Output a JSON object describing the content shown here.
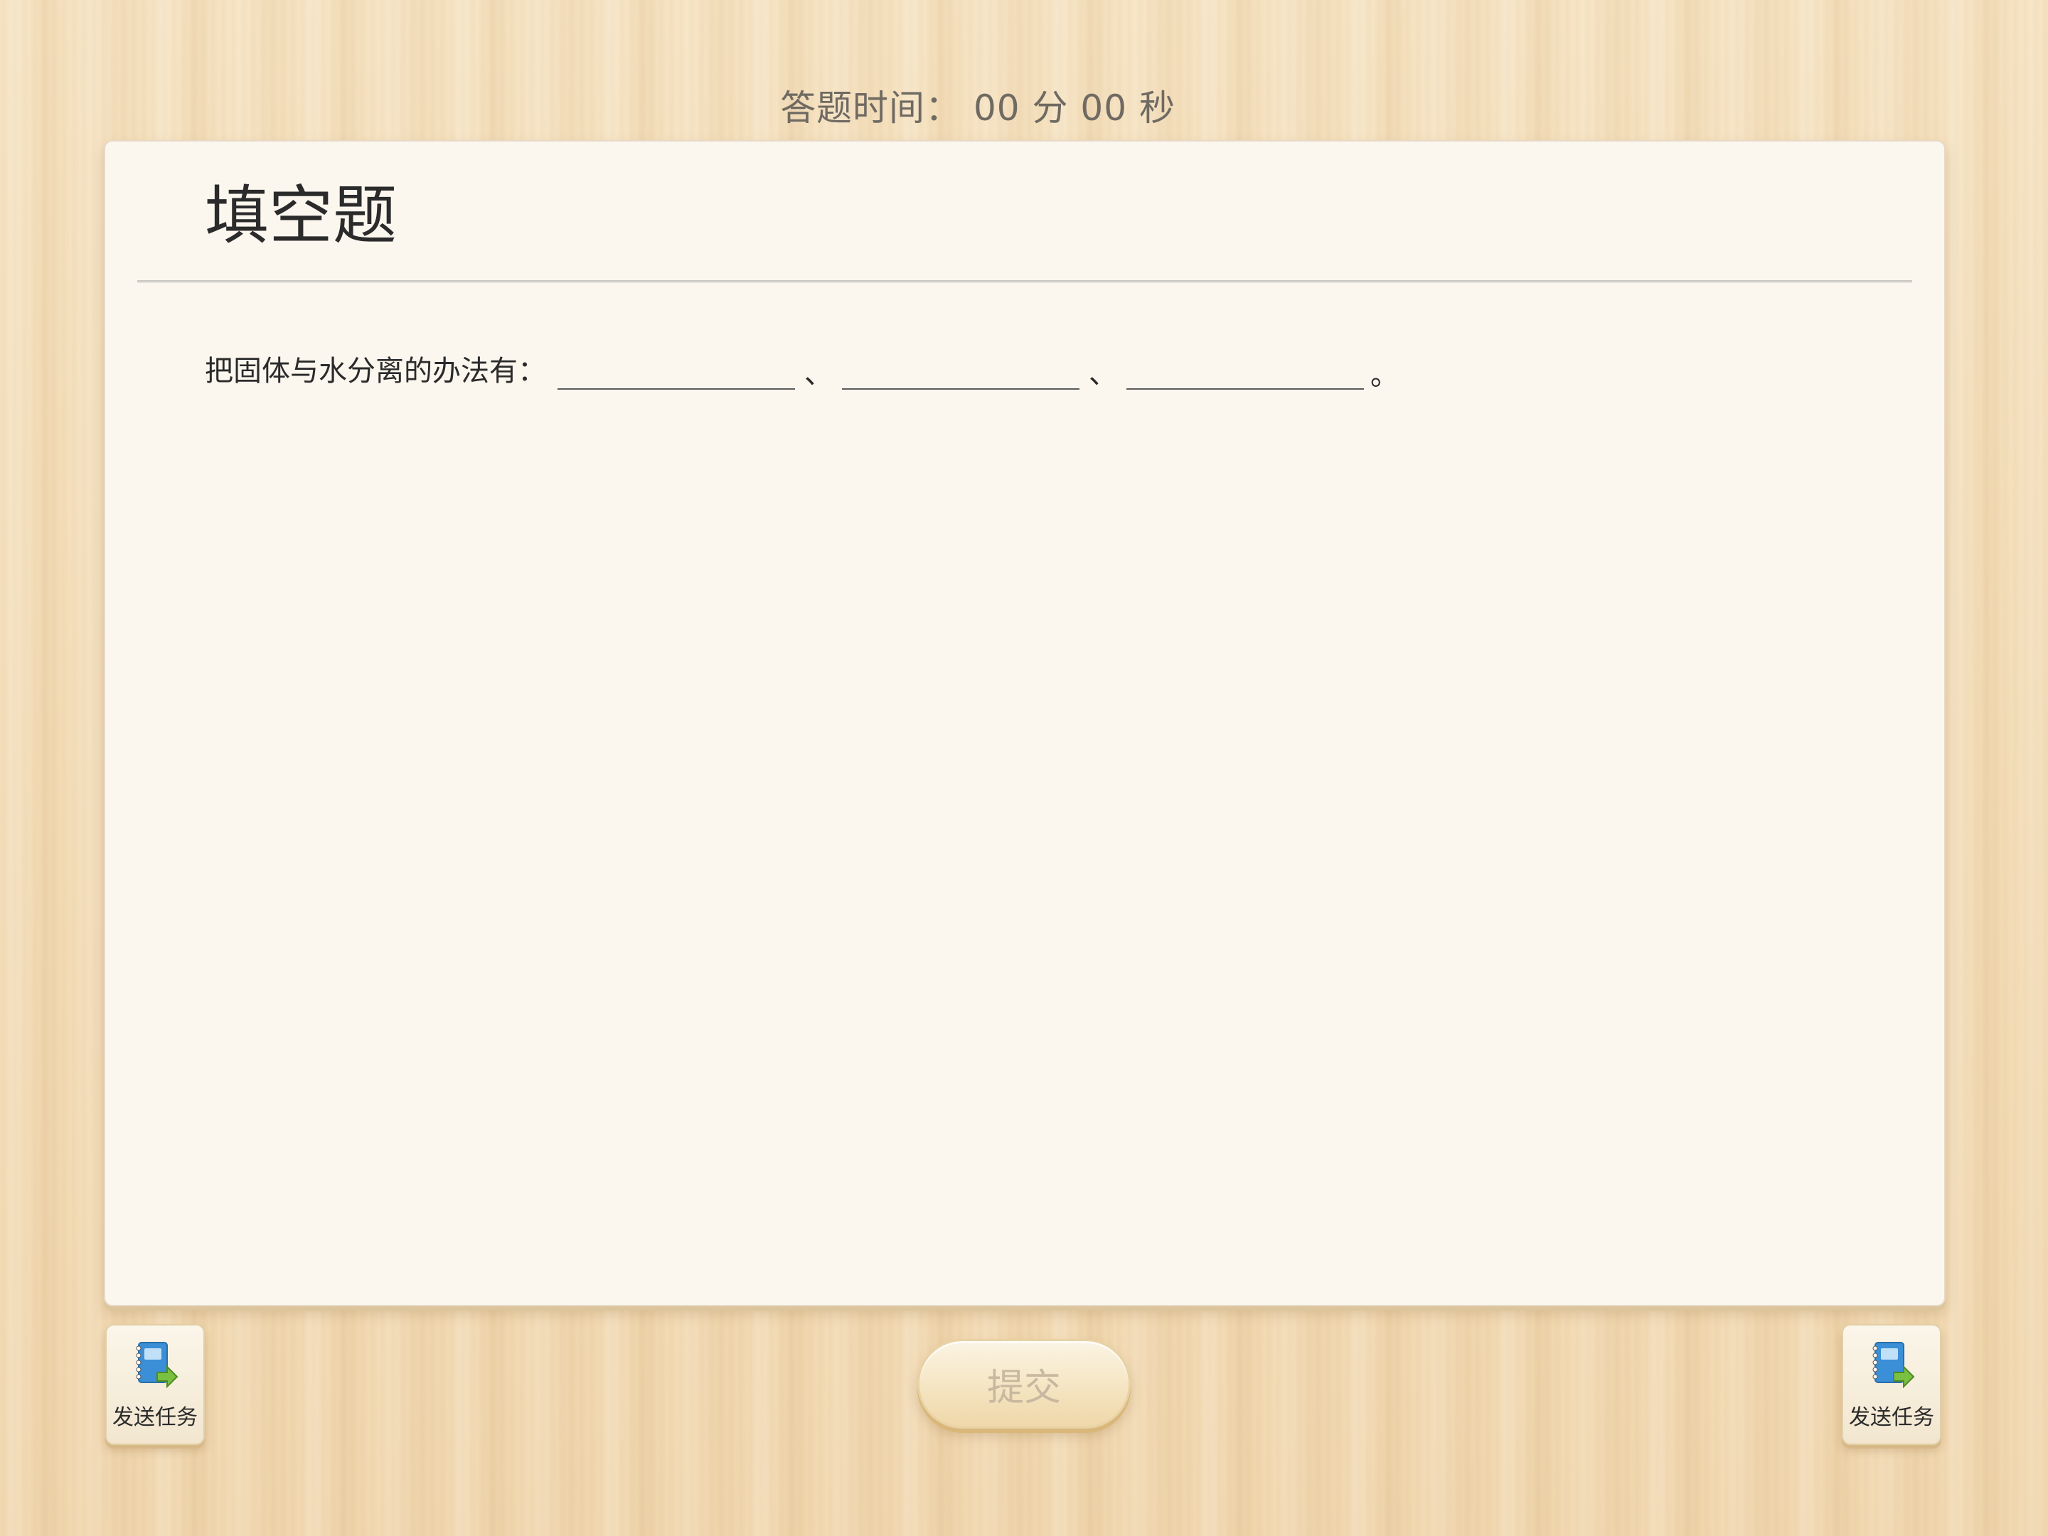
{
  "header": {
    "timer_label": "答题时间：",
    "minutes": "00",
    "minutes_unit": "分",
    "seconds": "00",
    "seconds_unit": "秒"
  },
  "question_card": {
    "title": "填空题",
    "question_text": "把固体与水分离的办法有：",
    "separator": "、",
    "end_mark": "。",
    "blanks": [
      {
        "value": ""
      },
      {
        "value": ""
      },
      {
        "value": ""
      }
    ]
  },
  "footer": {
    "send_task_left_label": "发送任务",
    "submit_label": "提交",
    "send_task_right_label": "发送任务"
  },
  "icons": {
    "send_task": "notebook-send-icon"
  },
  "colors": {
    "background_wood": "#f3dcb6",
    "card_background": "#fbf7ef",
    "text_dark": "#2b2b2b",
    "submit_text_disabled": "#c8b8a0",
    "icon_notebook": "#3a8fd6",
    "icon_arrow": "#7ac142"
  }
}
